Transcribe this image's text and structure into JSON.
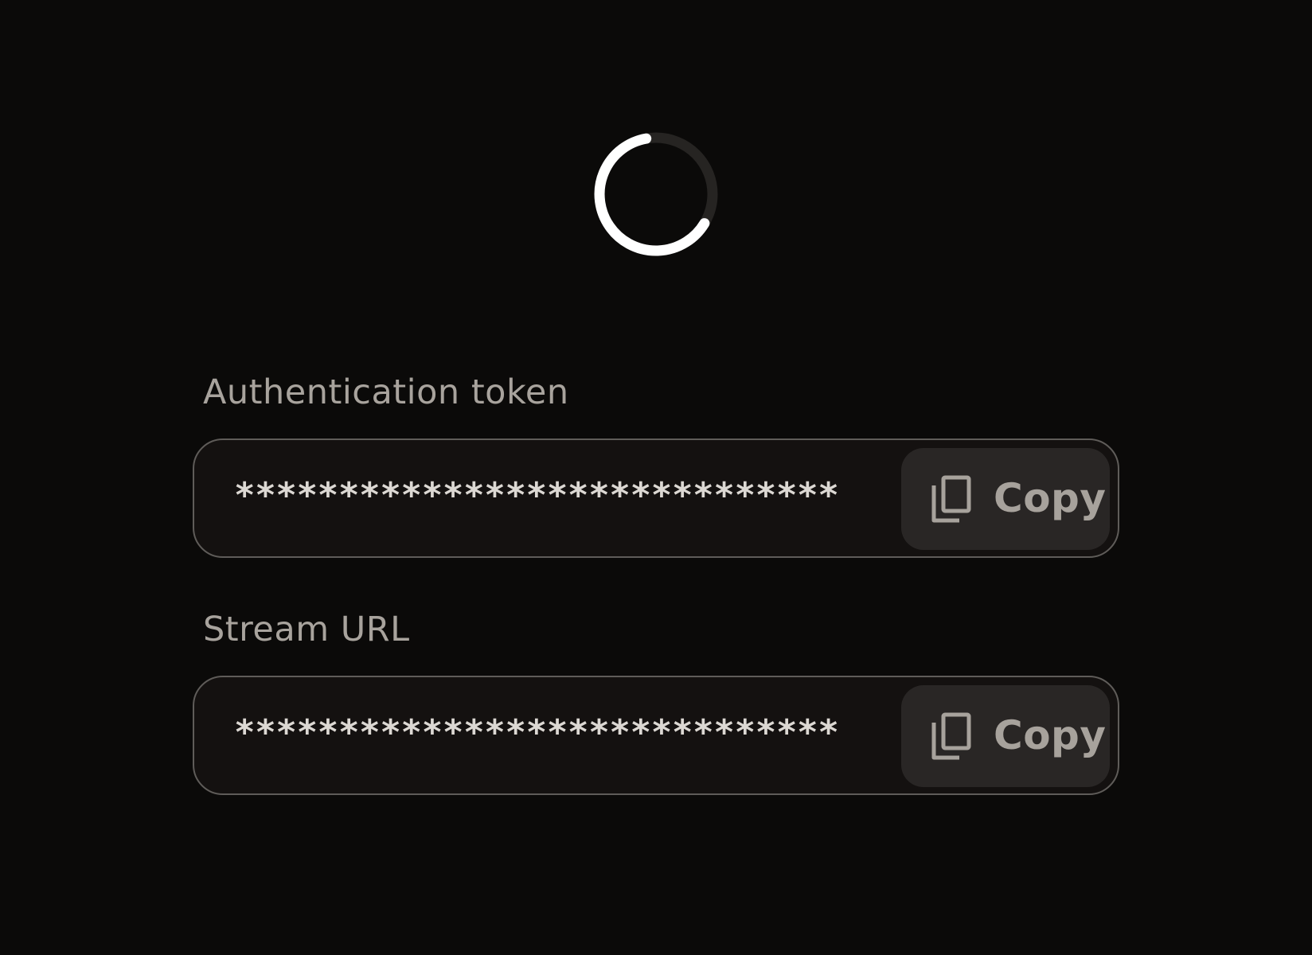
{
  "spinner": {
    "icon": "loading-spinner-icon",
    "track_color": "#262422",
    "arc_color": "#ffffff"
  },
  "fields": [
    {
      "label": "Authentication token",
      "value": "*****************************",
      "copy_label": "Copy",
      "copy_icon": "copy-icon"
    },
    {
      "label": "Stream URL",
      "value": "*****************************",
      "copy_label": "Copy",
      "copy_icon": "copy-icon"
    }
  ]
}
